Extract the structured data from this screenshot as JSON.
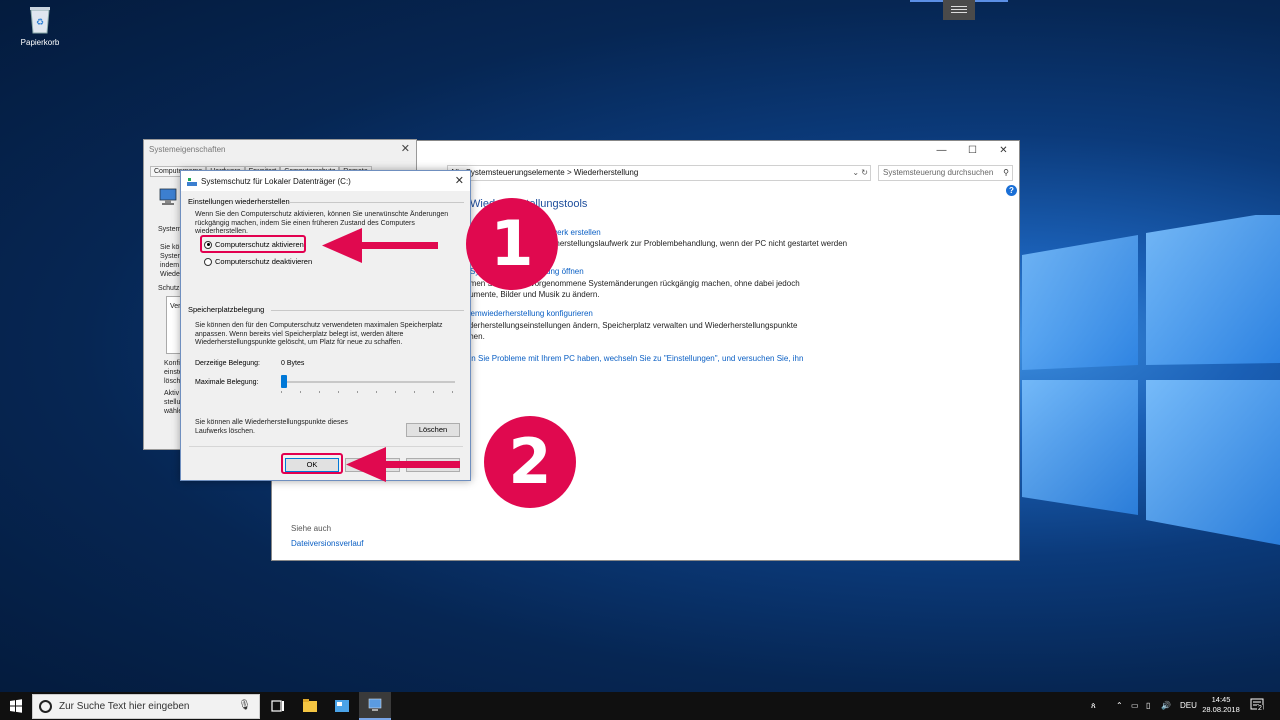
{
  "desktop": {
    "recycle_bin_label": "Papierkorb"
  },
  "control_panel": {
    "breadcrumb": "Alle Systemsteuerungselemente  >  Wiederherstellung",
    "search_placeholder": "Systemsteuerung durchsuchen",
    "heading": "Wiederherstellungstools",
    "item1_link": "Wiederherstellungslaufwerk erstellen",
    "item1_text": "Erstellen Sie ein Wiederherstellungslaufwerk zur Problembehandlung, wenn der PC nicht gestartet werden",
    "item2_link": "Systemwiederherstellung öffnen",
    "item2_text_a": "Nehmen Sie kürzlich vorgenommene Systemänderungen rückgängig machen, ohne dabei jedoch",
    "item2_text_b": "Dokumente, Bilder und Musik zu ändern.",
    "item3_link": "Systemwiederherstellung konfigurieren",
    "item3_text_a": "Wiederherstellungseinstellungen ändern, Speicherplatz verwalten und Wiederherstellungspunkte",
    "item3_text_b": "löschen.",
    "item4_text": "Wenn Sie Probleme mit Ihrem PC haben, wechseln Sie zu \"Einstellungen\", und versuchen Sie, ihn",
    "see_also": "Siehe auch",
    "see_also_link": "Dateiversionsverlauf"
  },
  "system_properties": {
    "title": "Systemeigenschaften",
    "tabs": [
      "Computername",
      "Hardware",
      "Erweitert",
      "Computerschutz",
      "Remote"
    ],
    "frag_system": "System",
    "frag_sie": "Sie kö\nSystem\nindem\nWiede",
    "frag_schutz": "Schutz",
    "frag_ver": "Ver",
    "frag_konf": "Konfi\neinste\nlösch",
    "frag_aktiv": "Aktiv\nstellu\nwähle"
  },
  "dialog": {
    "title": "Systemschutz für Lokaler Datenträger (C:)",
    "section_restore": "Einstellungen wiederherstellen",
    "restore_desc": "Wenn Sie den Computerschutz aktivieren, können Sie unerwünschte Änderungen rückgängig machen, indem Sie einen früheren Zustand des Computers wiederherstellen.",
    "radio_enable": "Computerschutz aktivieren",
    "radio_disable": "Computerschutz deaktivieren",
    "section_space": "Speicherplatzbelegung",
    "space_desc": "Sie können den für den Computerschutz verwendeten maximalen Speicherplatz anpassen. Wenn bereits viel Speicherplatz belegt ist, werden ältere Wiederherstellungspunkte gelöscht, um Platz für neue zu schaffen.",
    "current_label": "Derzeitige Belegung:",
    "current_value": "0 Bytes",
    "max_label": "Maximale Belegung:",
    "max_level": 0,
    "delete_desc": "Sie können alle Wiederherstellungspunkte dieses Laufwerks löschen.",
    "delete_button": "Löschen",
    "ok_button": "OK",
    "cancel_button": "Abbrechen",
    "apply_button": "Übernehmen"
  },
  "annotations": {
    "step1": "1",
    "step2": "2",
    "color": "#e0094f"
  },
  "taskbar": {
    "search_placeholder": "Zur Suche Text hier eingeben",
    "language": "DEU",
    "time": "14:45",
    "date": "28.08.2018",
    "notification_count": "2"
  }
}
